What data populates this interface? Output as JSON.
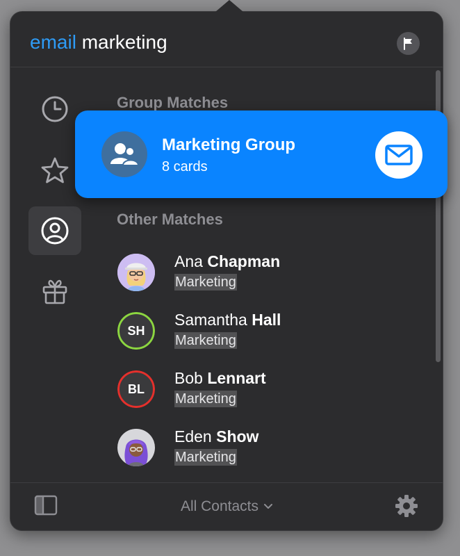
{
  "search": {
    "query_highlight": "email",
    "query_rest": " marketing"
  },
  "sidebar": {
    "items": [
      {
        "name": "recents",
        "icon": "clock-icon"
      },
      {
        "name": "favorites",
        "icon": "star-icon"
      },
      {
        "name": "contacts",
        "icon": "person-circle-icon",
        "active": true
      },
      {
        "name": "birthdays",
        "icon": "gift-icon"
      }
    ]
  },
  "sections": {
    "group_matches": "Group Matches",
    "other_matches": "Other Matches"
  },
  "group": {
    "title": "Marketing Group",
    "subtitle": "8 cards",
    "icon": "group-icon",
    "action_icon": "mail-icon",
    "color": "#0a84ff"
  },
  "contacts": [
    {
      "first": "Ana",
      "last": "Chapman",
      "sub": "Marketing",
      "avatar": "memoji",
      "initials": ""
    },
    {
      "first": "Samantha",
      "last": "Hall",
      "sub": "Marketing",
      "avatar": "initials",
      "initials": "SH",
      "ring": "#8cd640"
    },
    {
      "first": "Bob",
      "last": "Lennart",
      "sub": "Marketing",
      "avatar": "initials",
      "initials": "BL",
      "ring": "#e5302c"
    },
    {
      "first": "Eden",
      "last": "Show",
      "sub": "Marketing",
      "avatar": "memoji",
      "initials": ""
    }
  ],
  "footer": {
    "filter": "All Contacts",
    "left_icon": "sidebar-toggle-icon",
    "right_icon": "gear-icon"
  },
  "colors": {
    "accent": "#2e9bf5"
  }
}
